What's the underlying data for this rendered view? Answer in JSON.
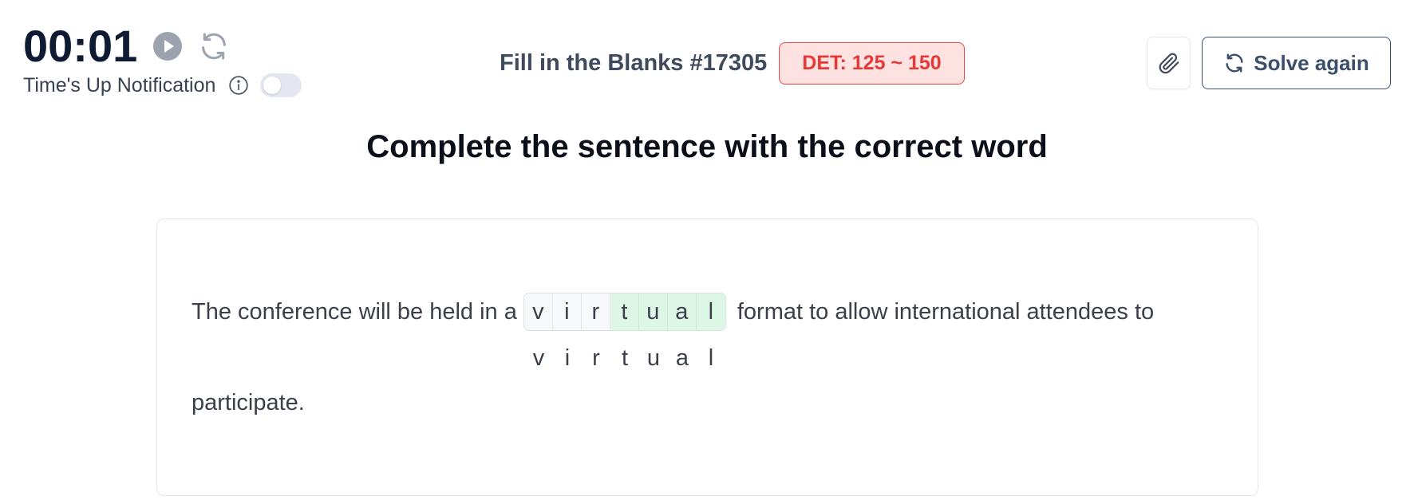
{
  "timer": {
    "display": "00:01"
  },
  "notification": {
    "label": "Time's Up Notification",
    "enabled": false
  },
  "header": {
    "title": "Fill in the Blanks #17305",
    "badge": "DET: 125 ~ 150"
  },
  "toolbar": {
    "solve_again_label": "Solve again"
  },
  "question": {
    "heading": "Complete the sentence with the correct word",
    "before": "The conference will be held in a",
    "after": "format to allow international attendees to",
    "end": "participate.",
    "given_letters": [
      "v",
      "i",
      "r"
    ],
    "filled_letters": [
      "t",
      "u",
      "a",
      "l"
    ],
    "answer_letters": [
      "v",
      "i",
      "r",
      "t",
      "u",
      "a",
      "l"
    ]
  },
  "colors": {
    "badge_bg": "#fee2e2",
    "badge_text": "#e53935",
    "filled_cell": "#ddf7e6",
    "primary": "#3b4f6b"
  }
}
